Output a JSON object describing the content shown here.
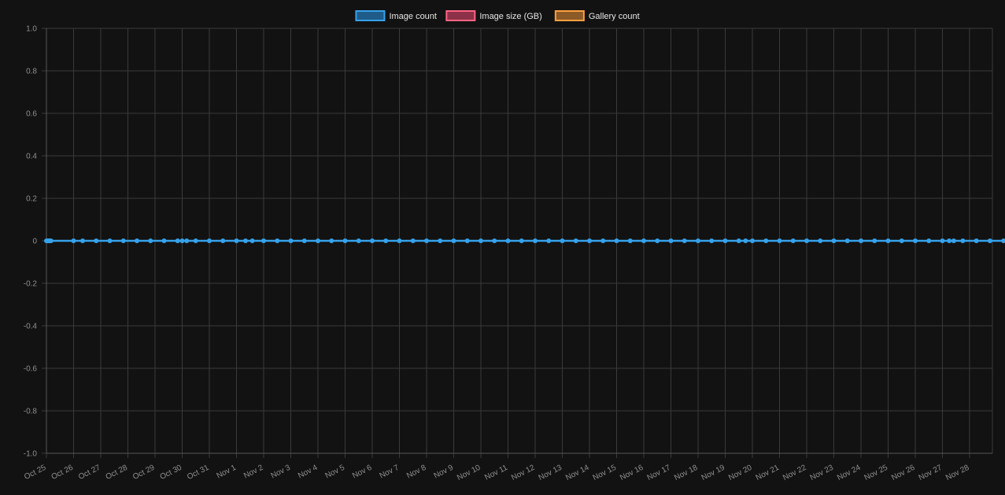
{
  "chart_data": {
    "type": "line",
    "x": [
      "Oct 25",
      "Oct 26",
      "Oct 27",
      "Oct 28",
      "Oct 29",
      "Oct 30",
      "Oct 31",
      "Nov 1",
      "Nov 2",
      "Nov 3",
      "Nov 4",
      "Nov 5",
      "Nov 6",
      "Nov 7",
      "Nov 8",
      "Nov 9",
      "Nov 10",
      "Nov 11",
      "Nov 12",
      "Nov 13",
      "Nov 14",
      "Nov 15",
      "Nov 16",
      "Nov 17",
      "Nov 18",
      "Nov 19",
      "Nov 20",
      "Nov 21",
      "Nov 22",
      "Nov 23",
      "Nov 24",
      "Nov 25",
      "Nov 26",
      "Nov 27",
      "Nov 28"
    ],
    "ylim": [
      -1.0,
      1.0
    ],
    "y_ticks": [
      "1.0",
      "0.8",
      "0.6",
      "0.4",
      "0.2",
      "0",
      "-0.2",
      "-0.4",
      "-0.6",
      "-0.8",
      "-1.0"
    ],
    "y_tick_values": [
      1.0,
      0.8,
      0.6,
      0.4,
      0.2,
      0,
      -0.2,
      -0.4,
      -0.6,
      -0.8,
      -1.0
    ],
    "grid": true,
    "legend_position": "top-center",
    "series": [
      {
        "name": "Image count",
        "color": "#36a2eb",
        "fill": "#1f5c8a",
        "visible": true
      },
      {
        "name": "Image size (GB)",
        "color": "#ff6384",
        "fill": "#8c3148",
        "visible": false
      },
      {
        "name": "Gallery count",
        "color": "#ff9f40",
        "fill": "#8c5a26",
        "visible": false
      }
    ],
    "points": [
      {
        "x": "2023-10-25T00:00",
        "y": 0
      },
      {
        "x": "2023-10-25T01:00",
        "y": 0
      },
      {
        "x": "2023-10-25T02:00",
        "y": 0
      },
      {
        "x": "2023-10-25T03:00",
        "y": 0
      },
      {
        "x": "2023-10-25T04:00",
        "y": 0
      },
      {
        "x": "2023-10-26T00:00",
        "y": 0
      },
      {
        "x": "2023-10-26T08:00",
        "y": 0
      },
      {
        "x": "2023-10-26T20:00",
        "y": 0
      },
      {
        "x": "2023-10-27T08:00",
        "y": 0
      },
      {
        "x": "2023-10-27T20:00",
        "y": 0
      },
      {
        "x": "2023-10-28T08:00",
        "y": 0
      },
      {
        "x": "2023-10-28T20:00",
        "y": 0
      },
      {
        "x": "2023-10-29T08:00",
        "y": 0
      },
      {
        "x": "2023-10-29T20:00",
        "y": 0
      },
      {
        "x": "2023-10-30T00:00",
        "y": 0
      },
      {
        "x": "2023-10-30T04:00",
        "y": 0
      },
      {
        "x": "2023-10-30T12:00",
        "y": 0
      },
      {
        "x": "2023-10-31T00:00",
        "y": 0
      },
      {
        "x": "2023-10-31T12:00",
        "y": 0
      },
      {
        "x": "2023-11-01T00:00",
        "y": 0
      },
      {
        "x": "2023-11-01T08:00",
        "y": 0
      },
      {
        "x": "2023-11-01T14:00",
        "y": 0
      },
      {
        "x": "2023-11-02T00:00",
        "y": 0
      },
      {
        "x": "2023-11-02T12:00",
        "y": 0
      },
      {
        "x": "2023-11-03T00:00",
        "y": 0
      },
      {
        "x": "2023-11-03T12:00",
        "y": 0
      },
      {
        "x": "2023-11-04T00:00",
        "y": 0
      },
      {
        "x": "2023-11-04T12:00",
        "y": 0
      },
      {
        "x": "2023-11-05T00:00",
        "y": 0
      },
      {
        "x": "2023-11-05T12:00",
        "y": 0
      },
      {
        "x": "2023-11-06T00:00",
        "y": 0
      },
      {
        "x": "2023-11-06T12:00",
        "y": 0
      },
      {
        "x": "2023-11-07T00:00",
        "y": 0
      },
      {
        "x": "2023-11-07T12:00",
        "y": 0
      },
      {
        "x": "2023-11-08T00:00",
        "y": 0
      },
      {
        "x": "2023-11-08T12:00",
        "y": 0
      },
      {
        "x": "2023-11-09T00:00",
        "y": 0
      },
      {
        "x": "2023-11-09T12:00",
        "y": 0
      },
      {
        "x": "2023-11-10T00:00",
        "y": 0
      },
      {
        "x": "2023-11-10T12:00",
        "y": 0
      },
      {
        "x": "2023-11-11T00:00",
        "y": 0
      },
      {
        "x": "2023-11-11T12:00",
        "y": 0
      },
      {
        "x": "2023-11-12T00:00",
        "y": 0
      },
      {
        "x": "2023-11-12T12:00",
        "y": 0
      },
      {
        "x": "2023-11-13T00:00",
        "y": 0
      },
      {
        "x": "2023-11-13T12:00",
        "y": 0
      },
      {
        "x": "2023-11-14T00:00",
        "y": 0
      },
      {
        "x": "2023-11-14T12:00",
        "y": 0
      },
      {
        "x": "2023-11-15T00:00",
        "y": 0
      },
      {
        "x": "2023-11-15T12:00",
        "y": 0
      },
      {
        "x": "2023-11-16T00:00",
        "y": 0
      },
      {
        "x": "2023-11-16T12:00",
        "y": 0
      },
      {
        "x": "2023-11-17T00:00",
        "y": 0
      },
      {
        "x": "2023-11-17T12:00",
        "y": 0
      },
      {
        "x": "2023-11-18T00:00",
        "y": 0
      },
      {
        "x": "2023-11-18T12:00",
        "y": 0
      },
      {
        "x": "2023-11-19T00:00",
        "y": 0
      },
      {
        "x": "2023-11-19T12:00",
        "y": 0
      },
      {
        "x": "2023-11-19T18:00",
        "y": 0
      },
      {
        "x": "2023-11-20T00:00",
        "y": 0
      },
      {
        "x": "2023-11-20T12:00",
        "y": 0
      },
      {
        "x": "2023-11-21T00:00",
        "y": 0
      },
      {
        "x": "2023-11-21T12:00",
        "y": 0
      },
      {
        "x": "2023-11-22T00:00",
        "y": 0
      },
      {
        "x": "2023-11-22T12:00",
        "y": 0
      },
      {
        "x": "2023-11-23T00:00",
        "y": 0
      },
      {
        "x": "2023-11-23T12:00",
        "y": 0
      },
      {
        "x": "2023-11-24T00:00",
        "y": 0
      },
      {
        "x": "2023-11-24T12:00",
        "y": 0
      },
      {
        "x": "2023-11-25T00:00",
        "y": 0
      },
      {
        "x": "2023-11-25T12:00",
        "y": 0
      },
      {
        "x": "2023-11-26T00:00",
        "y": 0
      },
      {
        "x": "2023-11-26T12:00",
        "y": 0
      },
      {
        "x": "2023-11-27T00:00",
        "y": 0
      },
      {
        "x": "2023-11-27T06:00",
        "y": 0
      },
      {
        "x": "2023-11-27T10:00",
        "y": 0
      },
      {
        "x": "2023-11-27T18:00",
        "y": 0
      },
      {
        "x": "2023-11-28T06:00",
        "y": 0
      },
      {
        "x": "2023-11-28T18:00",
        "y": 0
      },
      {
        "x": "2023-11-29T06:00",
        "y": 0
      }
    ]
  }
}
